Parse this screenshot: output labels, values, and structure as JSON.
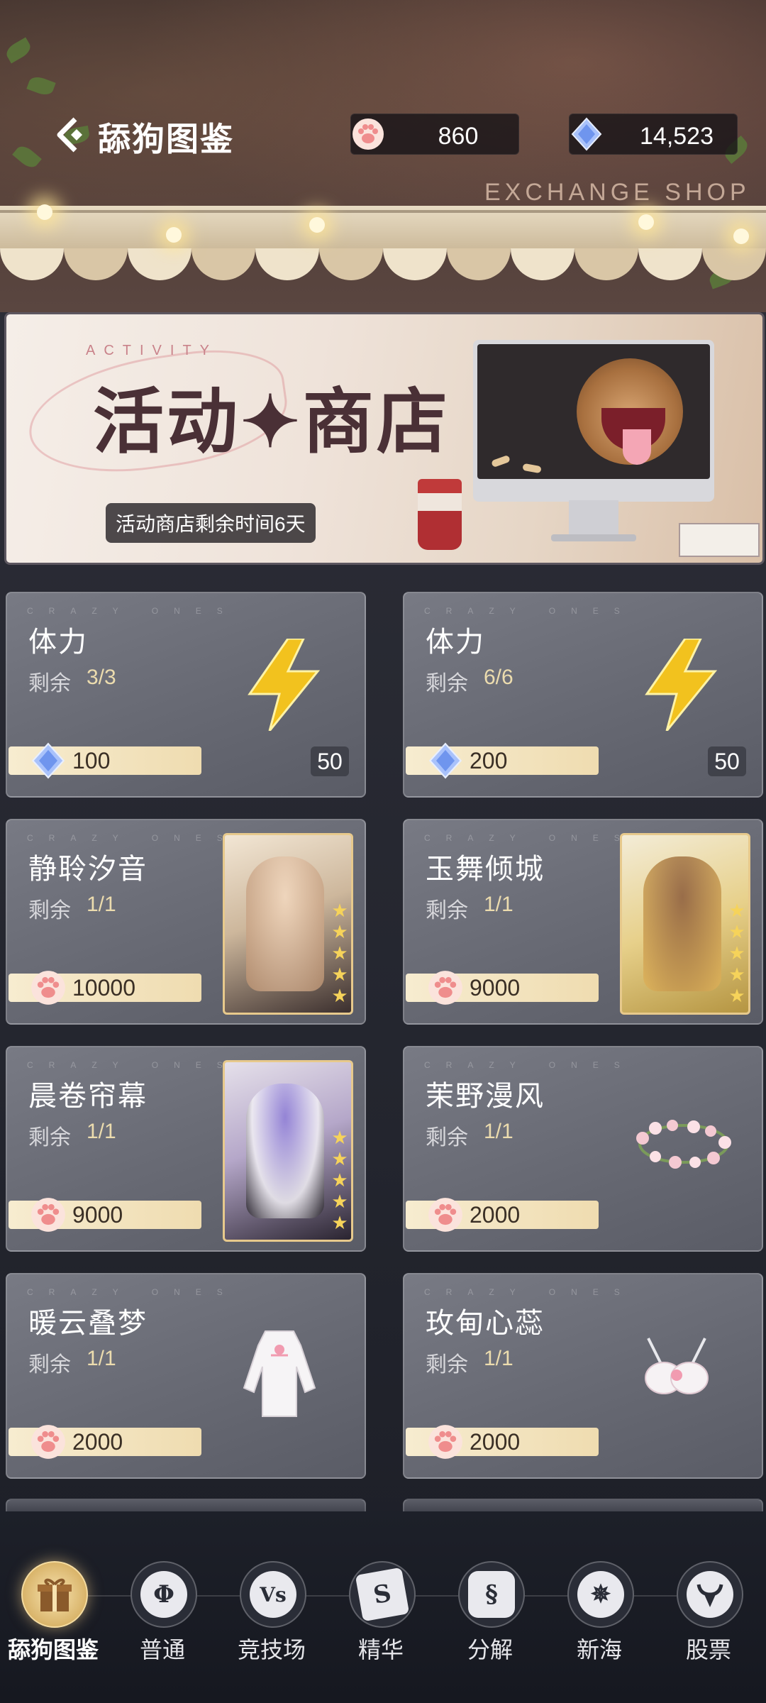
{
  "header": {
    "title": "舔狗图鉴",
    "paw_currency": "860",
    "gem_currency": "14,523",
    "shop_label": "EXCHANGE  SHOP"
  },
  "banner": {
    "activity_label": "ACTIVITY",
    "title": "活动✦商店",
    "timer": "活动商店剩余时间6天"
  },
  "items": [
    {
      "watermark": "CRAZY ONES",
      "name": "体力",
      "stock_label": "剩余",
      "stock": "3/3",
      "price": "100",
      "currency": "gem-icon",
      "qty": "50"
    },
    {
      "watermark": "CRAZY ONES",
      "name": "体力",
      "stock_label": "剩余",
      "stock": "6/6",
      "price": "200",
      "currency": "gem-icon",
      "qty": "50"
    },
    {
      "watermark": "CRAZY ONES",
      "name": "静聆汐音",
      "stock_label": "剩余",
      "stock": "1/1",
      "price": "10000",
      "currency": "paw-icon"
    },
    {
      "watermark": "CRAZY ONES",
      "name": "玉舞倾城",
      "stock_label": "剩余",
      "stock": "1/1",
      "price": "9000",
      "currency": "paw-icon"
    },
    {
      "watermark": "CRAZY ONES",
      "name": "晨卷帘幕",
      "stock_label": "剩余",
      "stock": "1/1",
      "price": "9000",
      "currency": "paw-icon"
    },
    {
      "watermark": "CRAZY ONES",
      "name": "茉野漫风",
      "stock_label": "剩余",
      "stock": "1/1",
      "price": "2000",
      "currency": "paw-icon"
    },
    {
      "watermark": "CRAZY ONES",
      "name": "暖云叠梦",
      "stock_label": "剩余",
      "stock": "1/1",
      "price": "2000",
      "currency": "paw-icon"
    },
    {
      "watermark": "CRAZY ONES",
      "name": "玫甸心蕊",
      "stock_label": "剩余",
      "stock": "1/1",
      "price": "2000",
      "currency": "paw-icon"
    }
  ],
  "nav": [
    {
      "label": "舔狗图鉴",
      "icon": "gift-icon",
      "active": true
    },
    {
      "label": "普通",
      "icon": "phi-icon"
    },
    {
      "label": "竞技场",
      "icon": "vs-icon"
    },
    {
      "label": "精华",
      "icon": "s-card-icon"
    },
    {
      "label": "分解",
      "icon": "s-hex-icon"
    },
    {
      "label": "新海",
      "icon": "compass-star-icon"
    },
    {
      "label": "股票",
      "icon": "bull-icon"
    }
  ],
  "colors": {
    "accent_gold": "#ecdcae",
    "price_bar": "#f7ecd0",
    "paw_pink": "#f08a8a",
    "gem_blue": "#7fa6f5"
  }
}
